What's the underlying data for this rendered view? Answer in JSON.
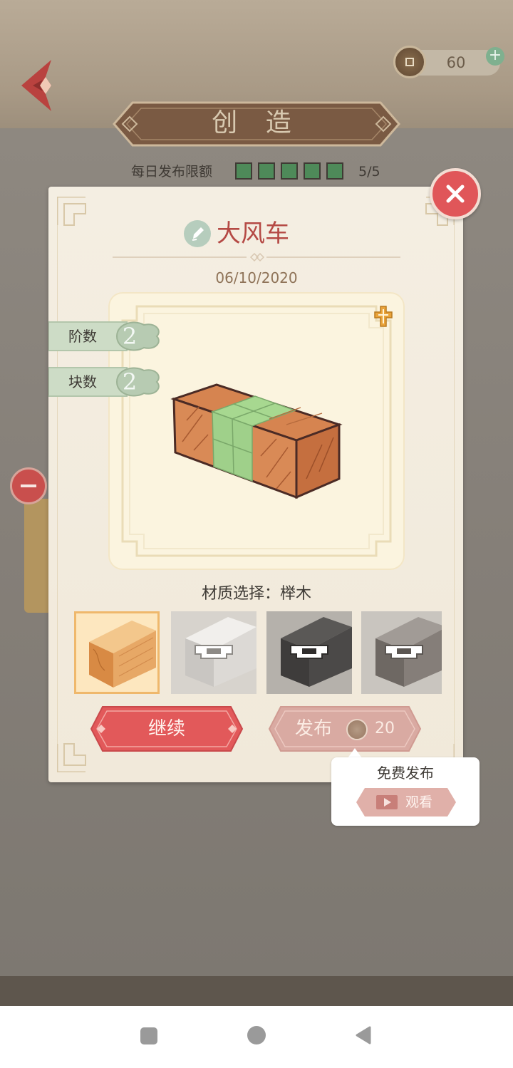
{
  "header": {
    "title": "创 造",
    "coins": "60"
  },
  "quota": {
    "label": "每日发布限额",
    "filled_boxes": 5,
    "total_boxes": 5,
    "count_text": "5/5"
  },
  "card": {
    "puzzle_name": "大风车",
    "date": "06/10/2020",
    "stats": [
      {
        "label": "阶数",
        "value": "2"
      },
      {
        "label": "块数",
        "value": "2"
      }
    ],
    "material_label": "材质选择：榉木",
    "materials": [
      {
        "name": "beech",
        "selected": true,
        "locked": false
      },
      {
        "name": "white-wood",
        "selected": false,
        "locked": true
      },
      {
        "name": "dark-wood",
        "selected": false,
        "locked": true
      },
      {
        "name": "gray-wood",
        "selected": false,
        "locked": true
      }
    ],
    "continue_label": "继续",
    "publish_label": "发布",
    "publish_cost": "20"
  },
  "tooltip": {
    "title": "免费发布",
    "watch_label": "观看"
  },
  "colors": {
    "accent_red": "#e05659",
    "quota_green": "#4e8a59",
    "card_bg": "#f4eee2"
  },
  "icons": {
    "back": "back-arrow-icon",
    "coin": "coin-icon",
    "add": "plus-icon",
    "close": "close-icon",
    "edit": "pencil-icon",
    "fit": "fit-view-icon",
    "lock": "lock-icon",
    "video": "video-icon"
  }
}
